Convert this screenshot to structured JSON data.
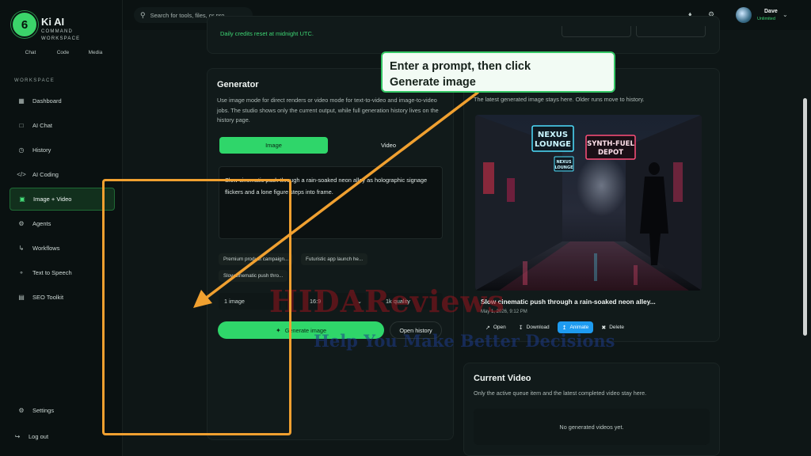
{
  "step_badge": "6",
  "brand": {
    "name": "Ki AI",
    "subtitle_line1": "COMMAND",
    "subtitle_line2": "WORKSPACE"
  },
  "sidebar": {
    "modes": [
      "Chat",
      "Code",
      "Media"
    ],
    "section_label": "WORKSPACE",
    "items": [
      {
        "label": "Dashboard",
        "icon": "grid-icon",
        "active": false
      },
      {
        "label": "AI Chat",
        "icon": "chat-icon",
        "active": false
      },
      {
        "label": "History",
        "icon": "clock-icon",
        "active": false
      },
      {
        "label": "AI Coding",
        "icon": "code-icon",
        "active": false
      },
      {
        "label": "Image + Video",
        "icon": "image-icon",
        "active": true
      },
      {
        "label": "Agents",
        "icon": "gear-icon",
        "active": false
      },
      {
        "label": "Workflows",
        "icon": "workflow-icon",
        "active": false
      },
      {
        "label": "Text to Speech",
        "icon": "speech-icon",
        "active": false
      },
      {
        "label": "SEO Toolkit",
        "icon": "chart-icon",
        "active": false
      }
    ],
    "settings_label": "Settings",
    "logout_label": "Log out"
  },
  "topbar": {
    "search_placeholder": "Search for tools, files, or pro",
    "user_name": "Dave",
    "user_plan": "Unlimited"
  },
  "credits_note": "Daily credits reset at midnight UTC.",
  "generator": {
    "title": "Generator",
    "description": "Use image mode for direct renders or video mode for text-to-video and image-to-video jobs. The studio shows only the current output, while full generation history lives on the history page.",
    "tab_image": "Image",
    "tab_video": "Video",
    "prompt": "Slow cinematic push through a rain-soaked neon alley as holographic signage flickers and a lone figure steps into frame.",
    "chips": [
      "Premium product campaign...",
      "Futuristic app launch he...",
      "Slow cinematic push thro..."
    ],
    "option_count": "1 image",
    "option_ratio": "16:9",
    "option_quality": "1k quality",
    "generate_label": "Generate image",
    "history_label": "Open history"
  },
  "latest": {
    "description": "The latest generated image stays here. Older runs move to history.",
    "sign1_line1": "NEXUS",
    "sign1_line2": "LOUNGE",
    "sign2_line1": "SYNTH-FUEL",
    "sign2_line2": "DEPOT",
    "sign3_line1": "NEXUS",
    "sign3_line2": "LOUNGE",
    "caption": "Slow cinematic push through a rain-soaked neon alley...",
    "date": "May 1, 2026, 9:12 PM",
    "actions": {
      "open": "Open",
      "download": "Download",
      "animate": "Animate",
      "delete": "Delete"
    }
  },
  "current_video": {
    "title": "Current Video",
    "description": "Only the active queue item and the latest completed video stay here.",
    "empty": "No generated videos yet."
  },
  "callout": {
    "line1": "Enter a prompt, then click",
    "line2": "Generate image"
  },
  "watermark": {
    "big": "HIDAReviews",
    "small": "Help You Make Better Decisions"
  },
  "colors": {
    "accent": "#2fd66a",
    "annotation": "#f0a030",
    "animate": "#1e9bf0"
  }
}
